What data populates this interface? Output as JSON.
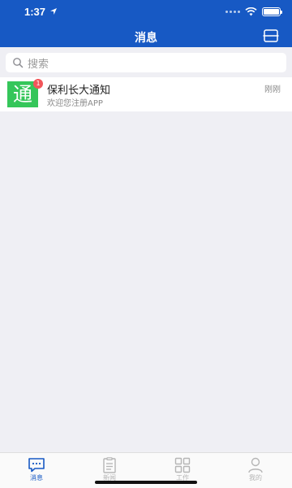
{
  "status_bar": {
    "time": "1:37"
  },
  "nav": {
    "title": "消息",
    "scan_icon": "scan-icon"
  },
  "search": {
    "placeholder": "搜索"
  },
  "messages": [
    {
      "avatar_char": "通",
      "badge": "1",
      "title": "保利长大通知",
      "subtitle": "欢迎您注册APP",
      "time": "刚刚",
      "avatar_color": "#35c65a"
    }
  ],
  "tabs": [
    {
      "label": "消息",
      "icon": "message-icon",
      "active": true
    },
    {
      "label": "新闻",
      "icon": "news-icon",
      "active": false
    },
    {
      "label": "工作",
      "icon": "work-grid-icon",
      "active": false
    },
    {
      "label": "我的",
      "icon": "profile-icon",
      "active": false
    }
  ],
  "colors": {
    "primary": "#1759c4",
    "background": "#efeff4",
    "badge": "#f2555a"
  }
}
